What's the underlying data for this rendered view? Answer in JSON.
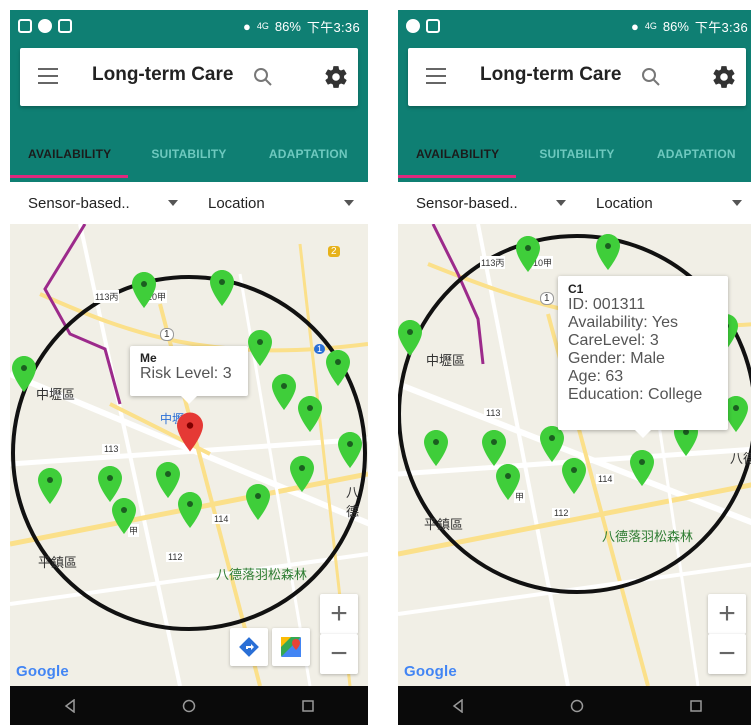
{
  "status": {
    "time": "下午3:36",
    "battery": "86%",
    "network": "4G"
  },
  "app": {
    "title": "Long-term Care"
  },
  "tabs": [
    {
      "label": "AVAILABILITY"
    },
    {
      "label": "SUITABILITY"
    },
    {
      "label": "ADAPTATION"
    }
  ],
  "filters": {
    "source": "Sensor-based..",
    "view": "Location"
  },
  "map_labels": {
    "road_113bing": "113丙",
    "road_110jia": "10甲",
    "road_113": "113",
    "road_114": "114",
    "road_112": "112",
    "road_110jia_b": "甲",
    "district_zhongli": "中壢區",
    "district_pingzhen": "平鎮區",
    "city_zhongli": "中壢市",
    "forest": "八德落羽松森林",
    "bade": "八德",
    "shield_1": "1",
    "shield_2": "2",
    "shield_66": "1"
  },
  "left_callout": {
    "title": "Me",
    "risk_level": "Risk Level: 3"
  },
  "right_callout": {
    "title": "C1",
    "id": "ID: 001311",
    "availability": "Availability: Yes",
    "care_level": "CareLevel: 3",
    "gender": "Gender: Male",
    "age": "Age: 63",
    "education": "Education: College"
  },
  "map_controls": {
    "zoom_in": "+",
    "zoom_out": "−"
  },
  "google_logo": "Google",
  "colors": {
    "appbar": "#0f7f73",
    "tab_indicator": "#e0287e",
    "pin_green": "#3fce3a",
    "pin_red": "#e53935",
    "circle": "#111111"
  }
}
